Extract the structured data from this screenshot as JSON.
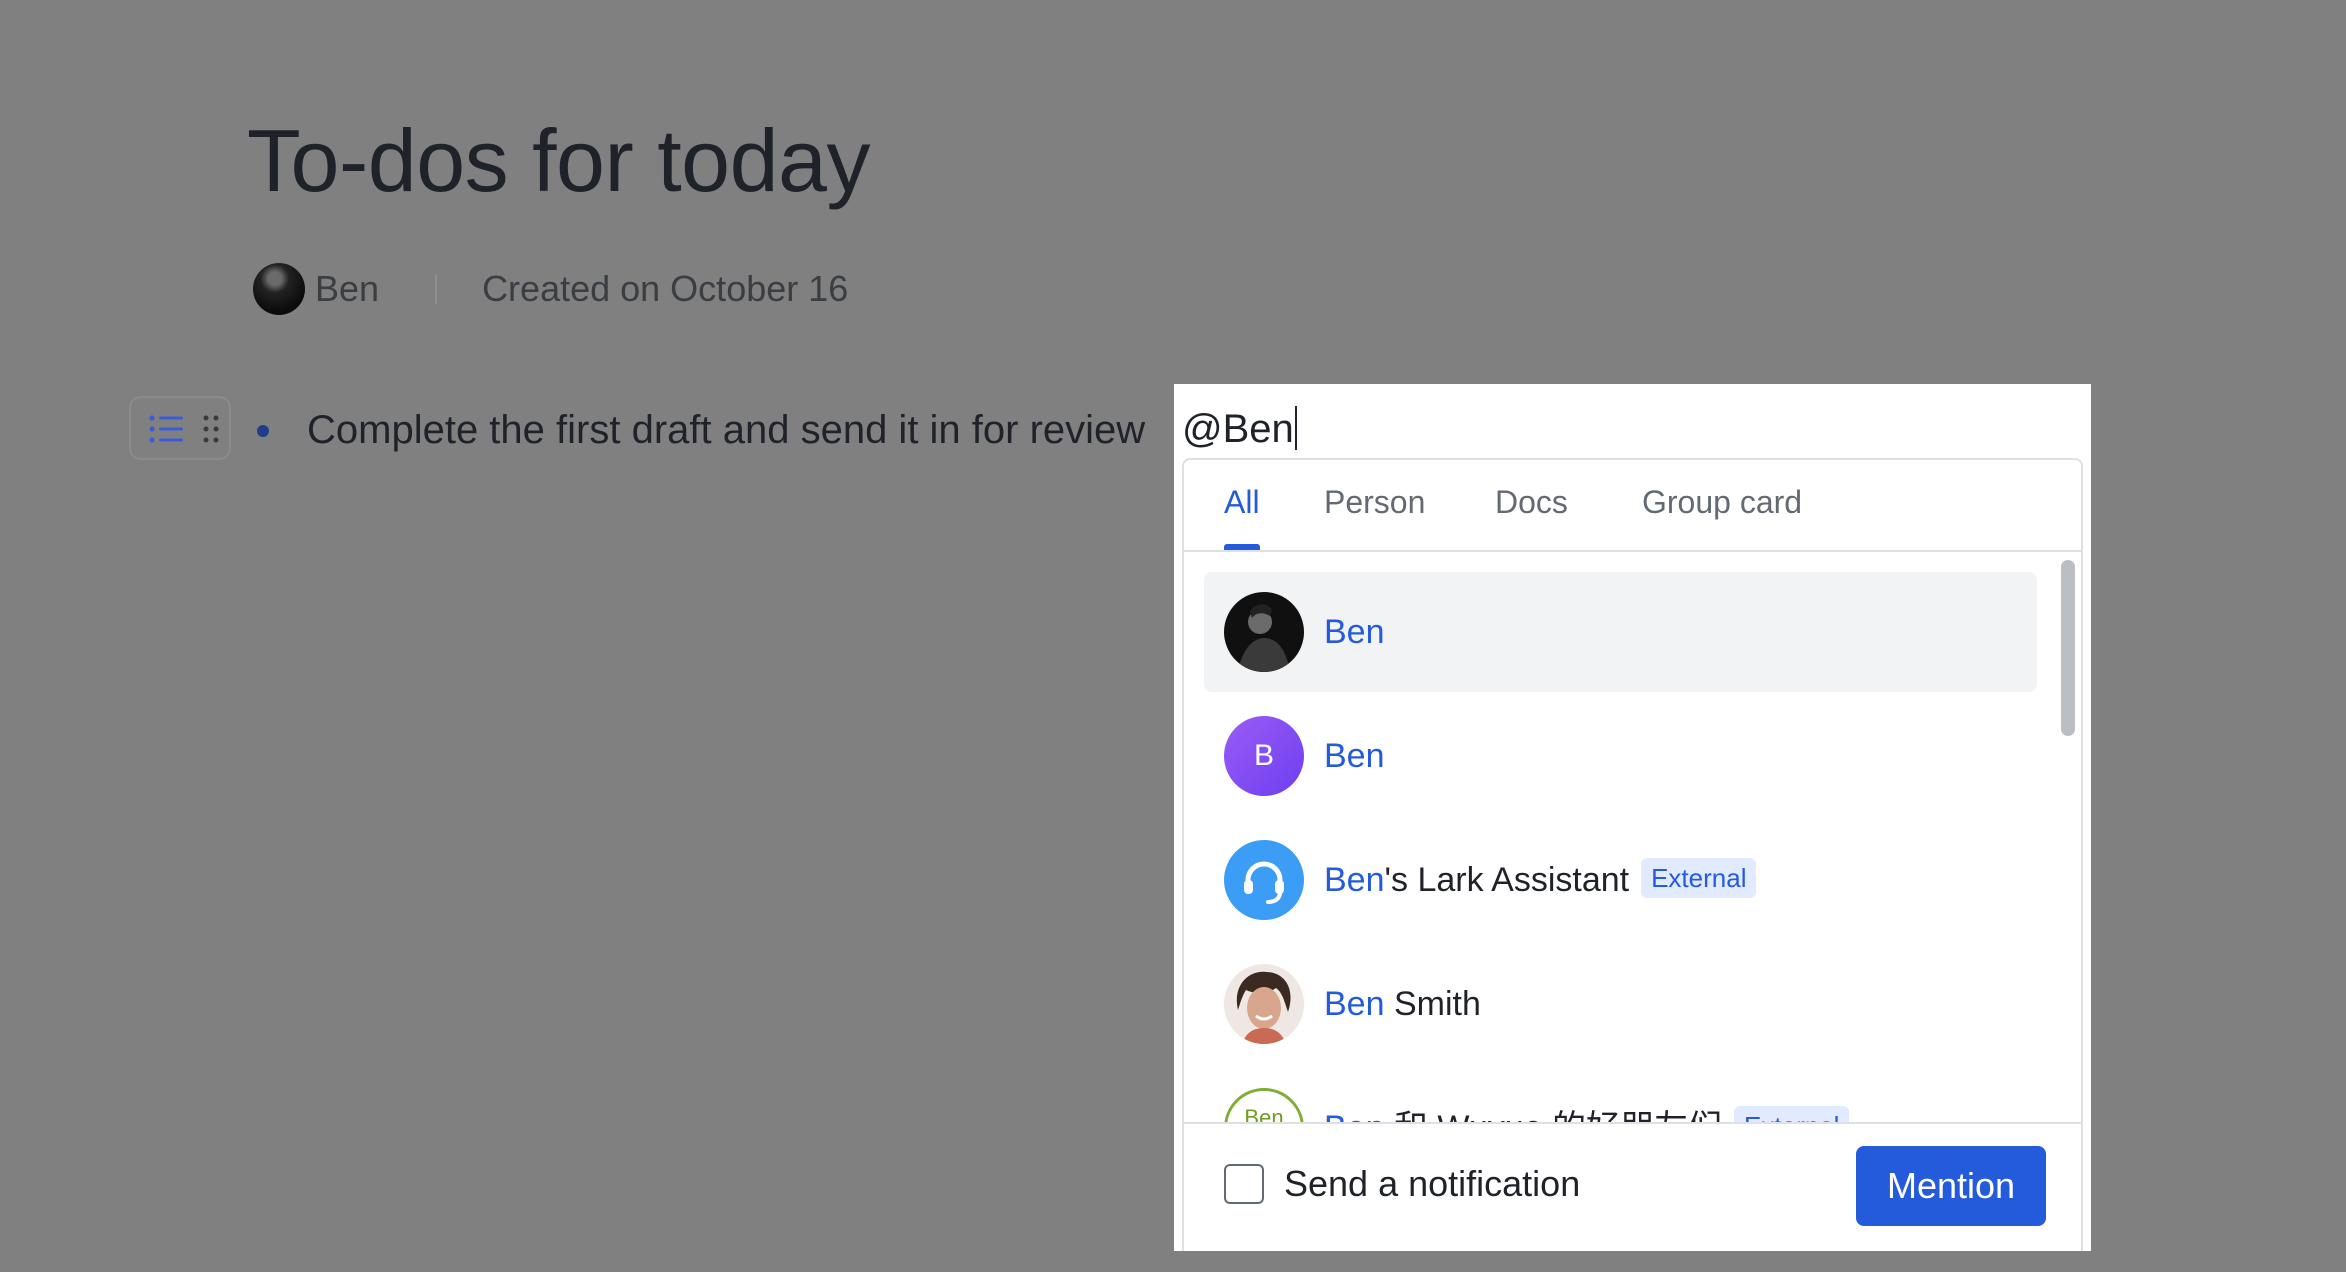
{
  "document": {
    "title": "To-dos for today",
    "author": "Ben",
    "created": "Created on October 16",
    "bullet_text": "Complete the first draft and send it in for review"
  },
  "mention": {
    "input_text": "@Ben",
    "tabs": [
      {
        "label": "All",
        "active": true
      },
      {
        "label": "Person"
      },
      {
        "label": "Docs"
      },
      {
        "label": "Group card"
      }
    ],
    "results": [
      {
        "highlight": "Ben",
        "rest": "",
        "avatar": "photo-dark",
        "selected": true
      },
      {
        "highlight": "Ben",
        "rest": "",
        "avatar": "letter",
        "avatar_letter": "B"
      },
      {
        "highlight": "Ben",
        "rest": "'s Lark Assistant",
        "badge": "External",
        "avatar": "headset-icon"
      },
      {
        "highlight": "Ben",
        "rest": " Smith",
        "avatar": "photo-curly"
      },
      {
        "highlight": "Ben",
        "rest": " 和 Wuyue 的好朋友们",
        "badge": "External",
        "avatar": "text",
        "avatar_text": "Ben"
      }
    ],
    "notification_label": "Send a notification",
    "notification_checked": false,
    "mention_button": "Mention"
  },
  "colors": {
    "accent": "#245bdb",
    "backdrop": "#808080",
    "badge_bg": "#e1eaff",
    "letter_avatar": "#7b4ff0",
    "assistant_avatar": "#3b9df5"
  }
}
